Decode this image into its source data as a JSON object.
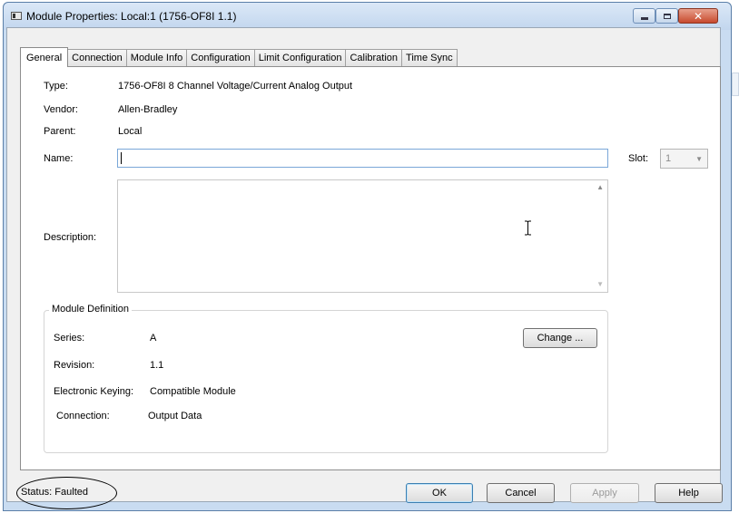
{
  "window": {
    "title": "Module Properties: Local:1 (1756-OF8I 1.1)"
  },
  "tabs": [
    {
      "label": "General"
    },
    {
      "label": "Connection"
    },
    {
      "label": "Module Info"
    },
    {
      "label": "Configuration"
    },
    {
      "label": "Limit Configuration"
    },
    {
      "label": "Calibration"
    },
    {
      "label": "Time Sync"
    }
  ],
  "general": {
    "type_label": "Type:",
    "type_value": "1756-OF8I 8 Channel Voltage/Current Analog Output",
    "vendor_label": "Vendor:",
    "vendor_value": "Allen-Bradley",
    "parent_label": "Parent:",
    "parent_value": "Local",
    "name_label": "Name:",
    "name_value": "",
    "slot_label": "Slot:",
    "slot_value": "1",
    "description_label": "Description:",
    "description_value": ""
  },
  "module_definition": {
    "title": "Module Definition",
    "series_label": "Series:",
    "series_value": "A",
    "revision_label": "Revision:",
    "revision_value": "1.1",
    "keying_label": "Electronic Keying:",
    "keying_value": "Compatible Module",
    "connection_label": "Connection:",
    "connection_value": "Output Data",
    "change_button": "Change ..."
  },
  "status": {
    "text": "Status:  Faulted"
  },
  "buttons": {
    "ok": "OK",
    "cancel": "Cancel",
    "apply": "Apply",
    "help": "Help"
  },
  "icons": {
    "app": "module-window-icon",
    "minimize": "minimize-icon",
    "maximize": "maximize-icon",
    "close": "close-icon",
    "slot_dropdown": "chevron-down-icon",
    "text_cursor": "ibeam-cursor-icon"
  },
  "colors": {
    "titlebar": "#c9dcf1",
    "close_button": "#c74a2e",
    "focus_border": "#7aa7d8"
  }
}
